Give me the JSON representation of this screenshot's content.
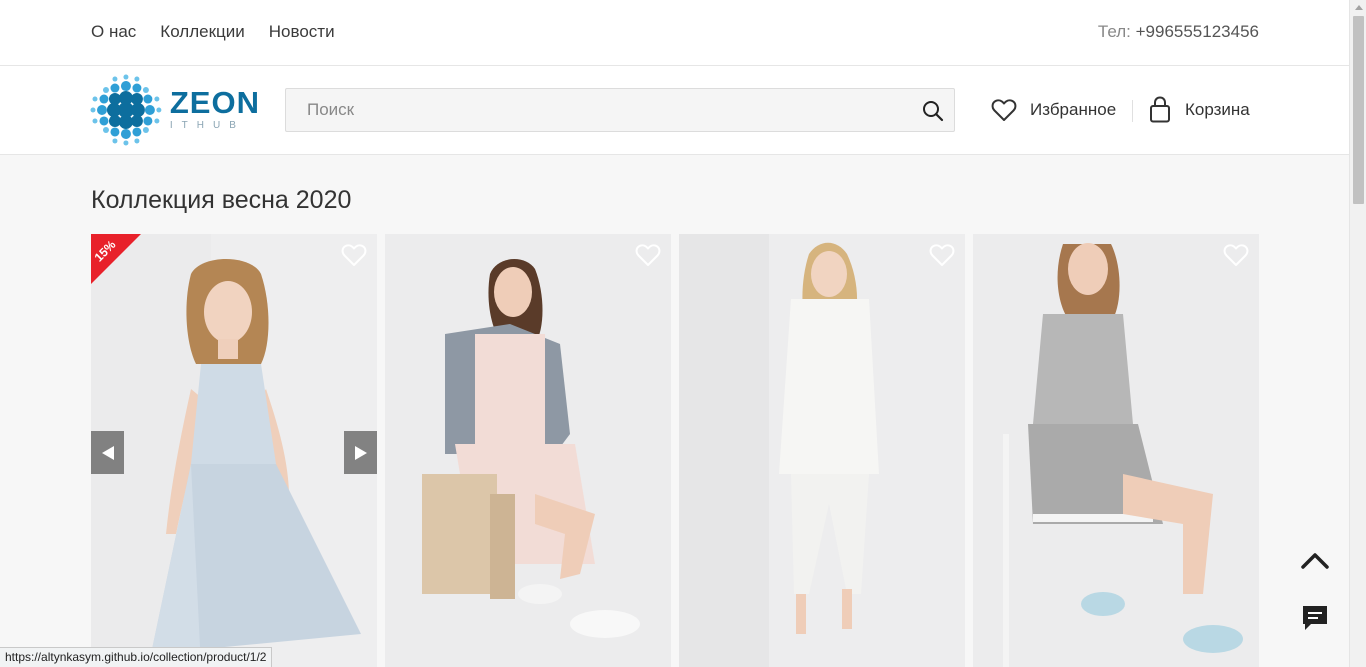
{
  "topnav": {
    "items": [
      "О нас",
      "Коллекции",
      "Новости"
    ],
    "phone_label": "Тел:",
    "phone_number": "+996555123456"
  },
  "header": {
    "logo_name": "ZEON",
    "logo_sub": "ITHUB",
    "search_placeholder": "Поиск",
    "favorites_label": "Избранное",
    "cart_label": "Корзина"
  },
  "section": {
    "title": "Коллекция весна 2020"
  },
  "products": [
    {
      "badge": "15%",
      "dress_color": "#cfdbe6"
    },
    {
      "dress_color": "#f2dcd6"
    },
    {
      "dress_color": "#f6f6f4"
    },
    {
      "dress_color": "#b7b7b7"
    }
  ],
  "status_url": "https://altynkasym.github.io/collection/product/1/2",
  "colors": {
    "brand": "#0d6e9e",
    "badge": "#e8212a"
  },
  "icons": [
    "search-icon",
    "heart-icon",
    "bag-icon",
    "chevron-up-icon",
    "chat-icon",
    "arrow-left-icon",
    "arrow-right-icon"
  ]
}
